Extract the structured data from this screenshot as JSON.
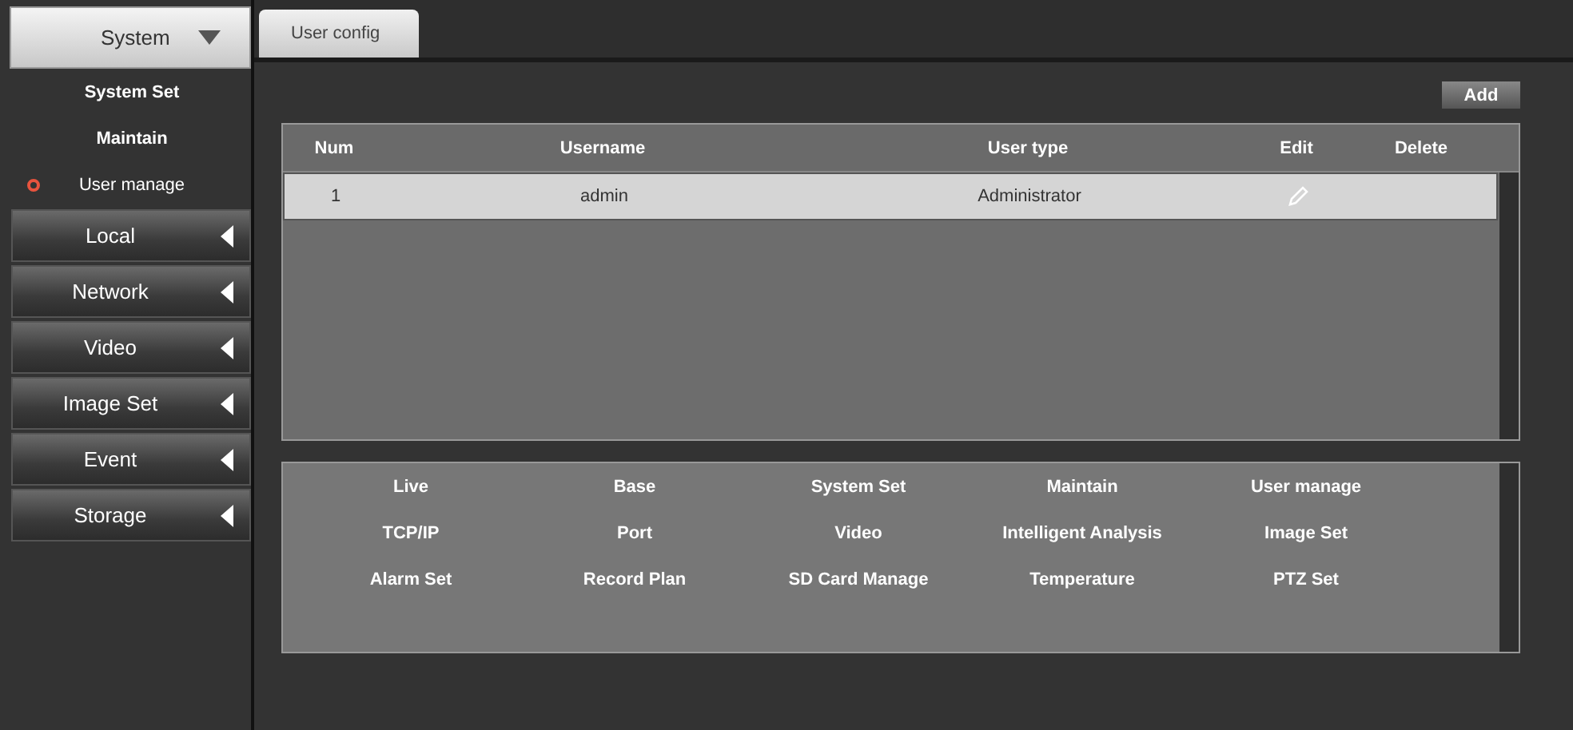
{
  "sidebar": {
    "header": {
      "label": "System",
      "expanded": true
    },
    "items": [
      {
        "label": "System Set",
        "selected": false
      },
      {
        "label": "Maintain",
        "selected": false
      },
      {
        "label": "User manage",
        "selected": true
      }
    ],
    "sections": [
      {
        "label": "Local",
        "expanded": false
      },
      {
        "label": "Network",
        "expanded": false
      },
      {
        "label": "Video",
        "expanded": false
      },
      {
        "label": "Image Set",
        "expanded": false
      },
      {
        "label": "Event",
        "expanded": false
      },
      {
        "label": "Storage",
        "expanded": false
      }
    ]
  },
  "tabs": [
    {
      "label": "User config",
      "selected": true
    }
  ],
  "add_button": "Add",
  "table": {
    "columns": [
      "Num",
      "Username",
      "User type",
      "Edit",
      "Delete"
    ],
    "rows": [
      {
        "num": "1",
        "username": "admin",
        "user_type": "Administrator",
        "selected": true
      }
    ]
  },
  "permissions": [
    "Live",
    "Base",
    "System Set",
    "Maintain",
    "User manage",
    "TCP/IP",
    "Port",
    "Video",
    "Intelligent Analysis",
    "Image Set",
    "Alarm Set",
    "Record Plan",
    "SD Card Manage",
    "Temperature",
    "PTZ Set"
  ]
}
